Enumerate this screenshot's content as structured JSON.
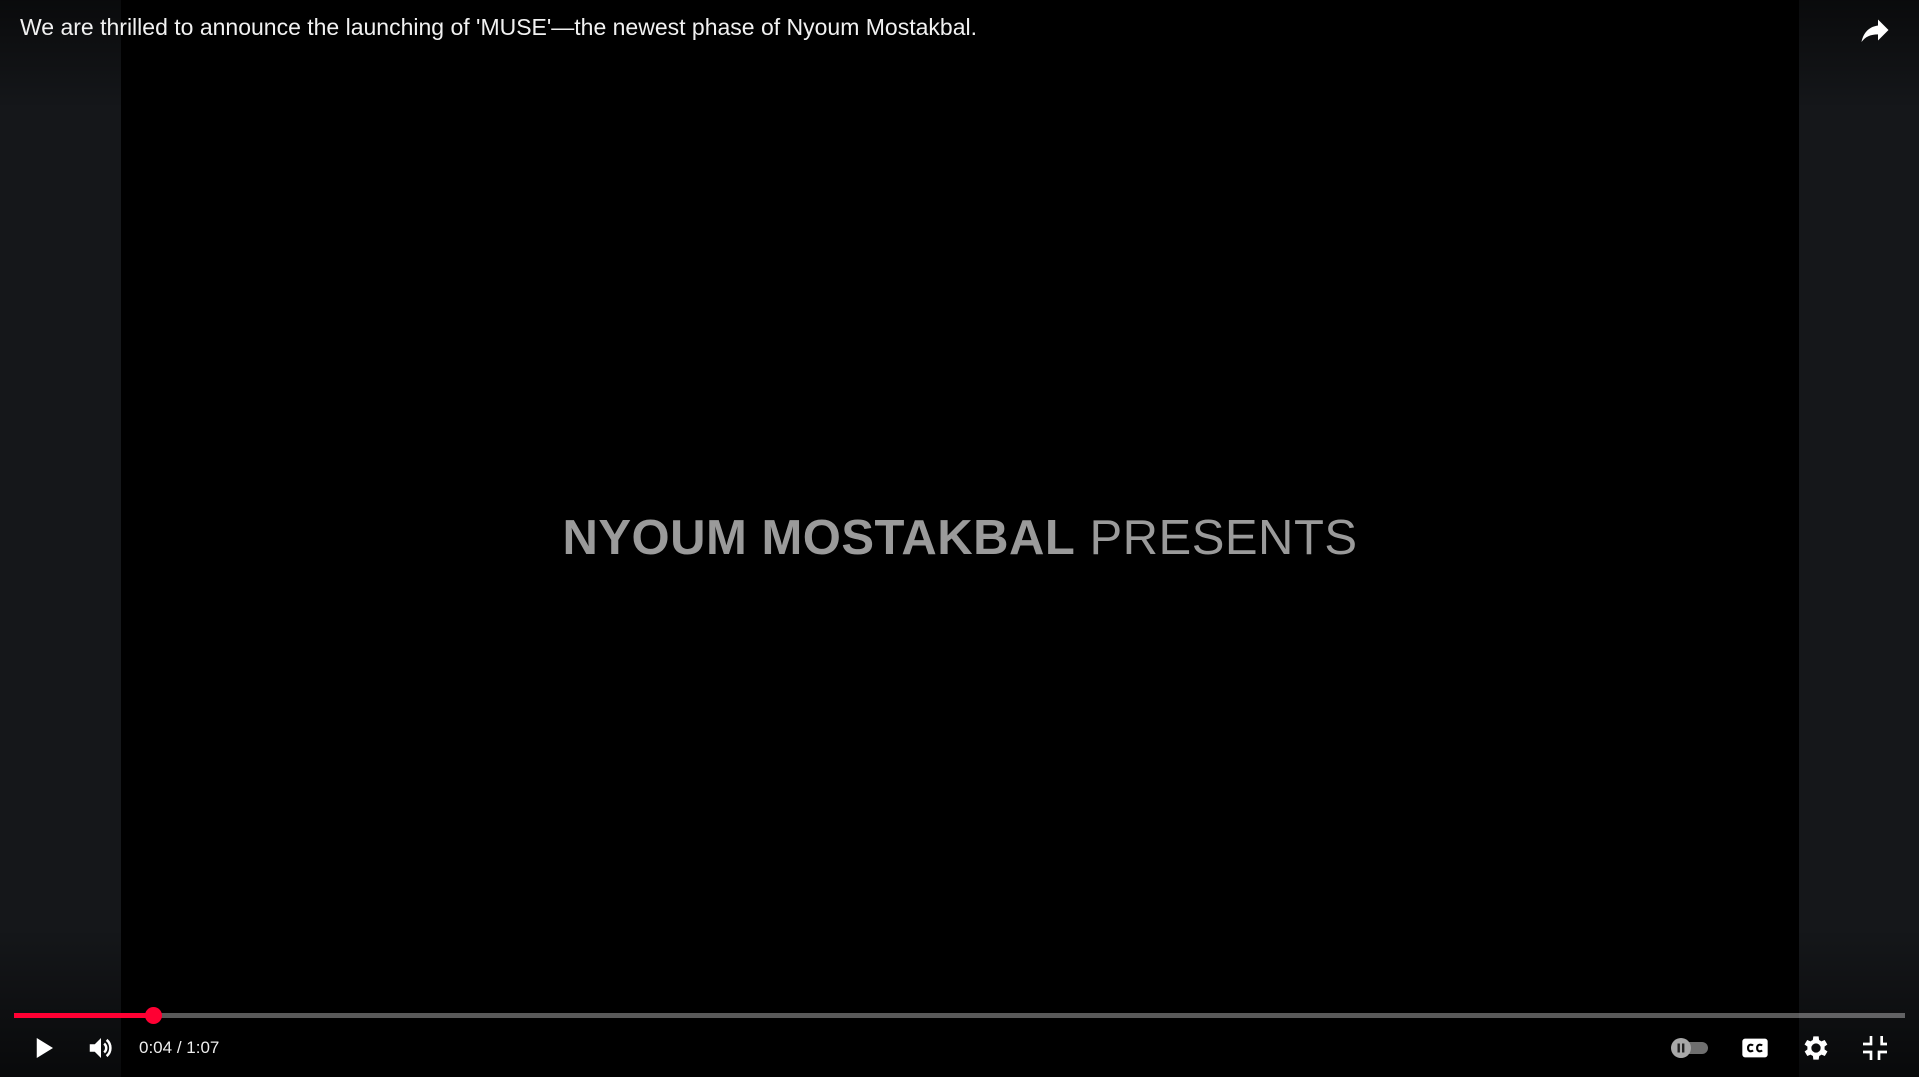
{
  "video": {
    "title": "We are thrilled to announce the launching of 'MUSE'—the newest phase of Nyoum Mostakbal.",
    "frame_text_bold": "NYOUM MOSTAKBAL",
    "frame_text_light": " PRESENTS"
  },
  "controls": {
    "current_time": "0:04",
    "separator": " / ",
    "duration": "1:07",
    "progress_fraction": 0.0735,
    "autoplay_enabled": false
  },
  "icons": {
    "share": "share-icon",
    "play": "play-icon",
    "volume": "volume-icon",
    "autoplay": "autoplay-toggle-icon",
    "captions": "cc-icon",
    "settings": "gear-icon",
    "exit_fullscreen": "exit-fullscreen-icon"
  },
  "colors": {
    "progress_played": "#ff0033",
    "text": "#f1f1f1",
    "video_text": "#9a9a9a"
  }
}
